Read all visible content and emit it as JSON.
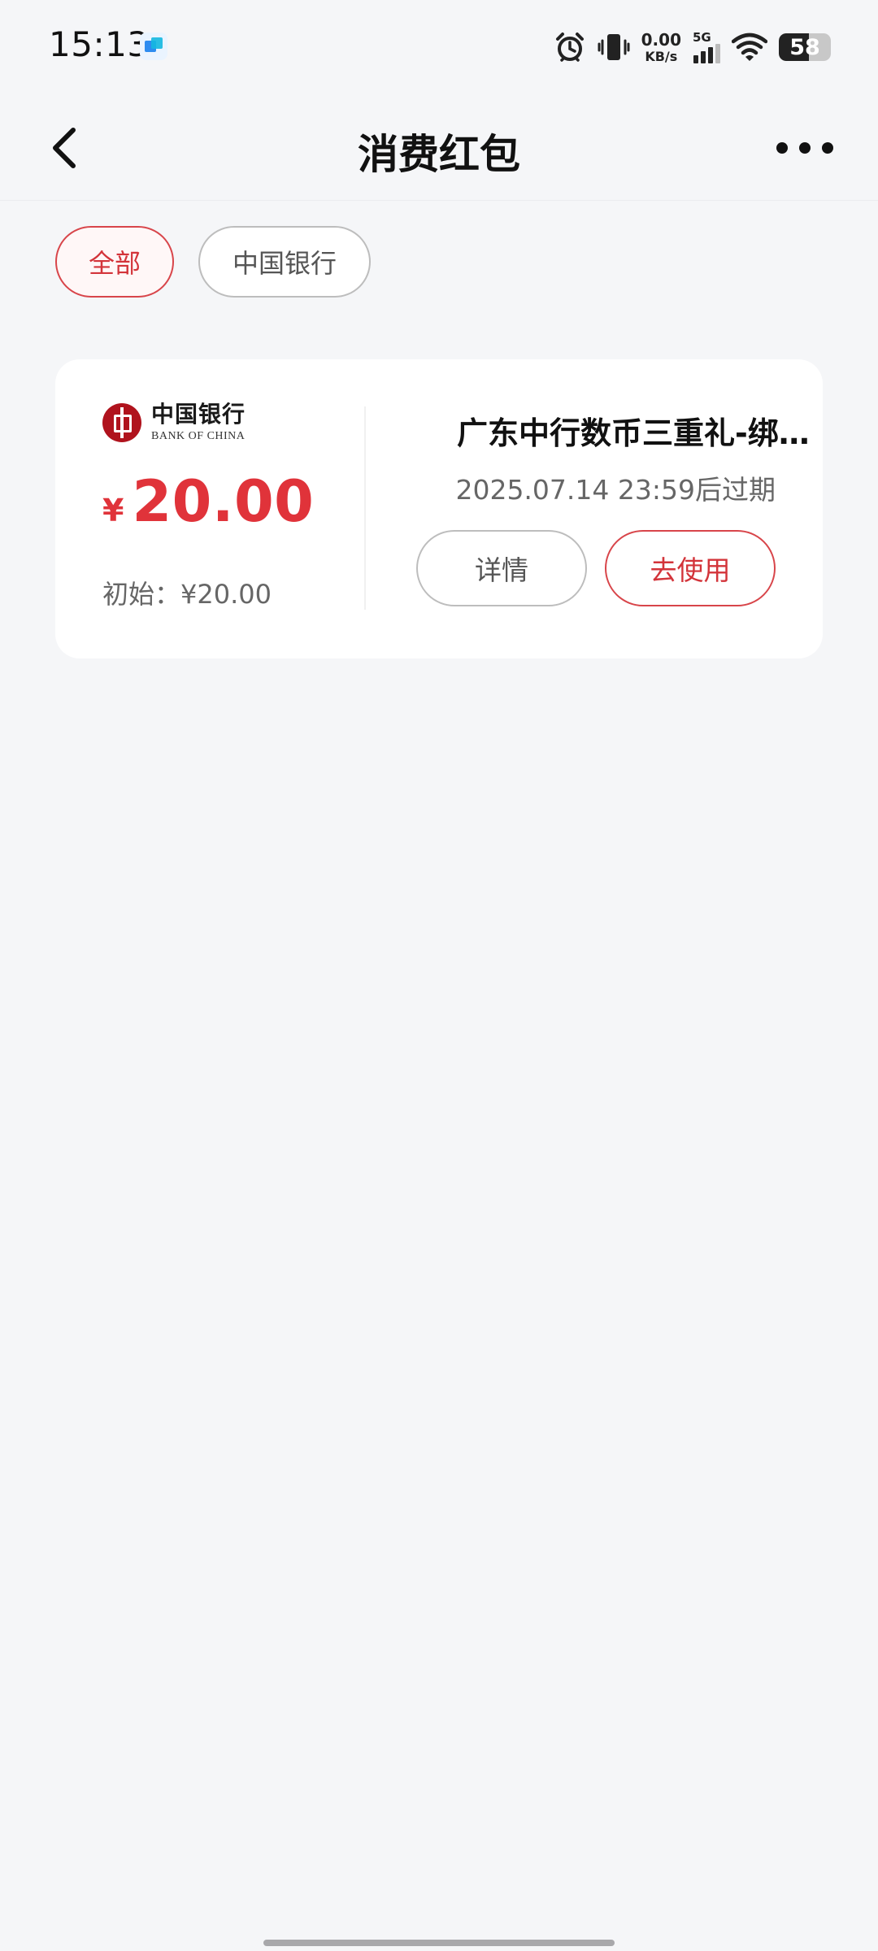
{
  "status_bar": {
    "time": "15:13",
    "net_speed_value": "0.00",
    "net_speed_unit": "KB/s",
    "network_type": "5G",
    "battery_level": "58",
    "battery_fraction": 0.58,
    "icons": [
      "app-notification-icon",
      "alarm-icon",
      "vibrate-icon",
      "signal-icon",
      "wifi-icon",
      "battery-icon"
    ]
  },
  "nav": {
    "title": "消费红包",
    "back_icon": "chevron-left-icon",
    "more_icon": "more-horizontal-icon"
  },
  "filters": [
    {
      "label": "全部",
      "active": true
    },
    {
      "label": "中国银行",
      "active": false
    }
  ],
  "coupon": {
    "bank_name_cn": "中国银行",
    "bank_name_en": "BANK OF CHINA",
    "currency_symbol": "¥",
    "amount": "20.00",
    "initial_label": "初始：¥20.00",
    "title": "广东中行数币三重礼-绑…",
    "expire": "2025.07.14 23:59后过期",
    "detail_label": "详情",
    "use_label": "去使用"
  },
  "colors": {
    "accent_red": "#e0333a",
    "background": "#f5f6f8",
    "card": "#ffffff",
    "bank_red": "#b0131d"
  }
}
